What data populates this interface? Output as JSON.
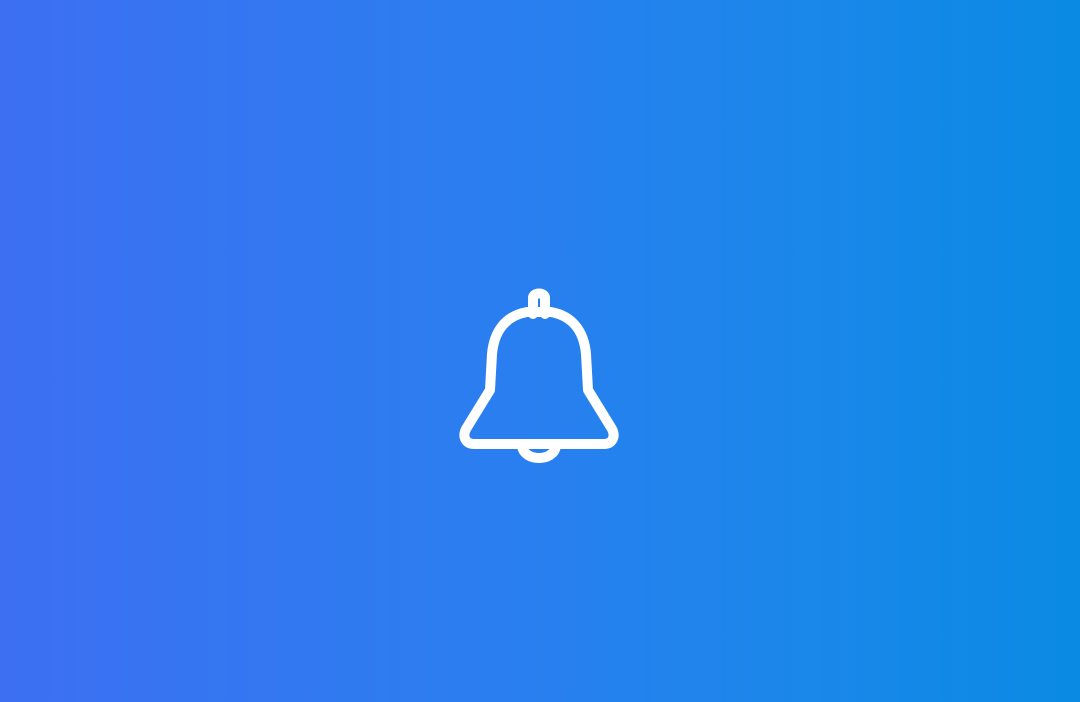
{
  "background": {
    "gradient_start": "#3d6ff2",
    "gradient_end": "#0a8ae3"
  },
  "notification": {
    "icon": "bell-icon",
    "icon_color": "#ffffff"
  }
}
